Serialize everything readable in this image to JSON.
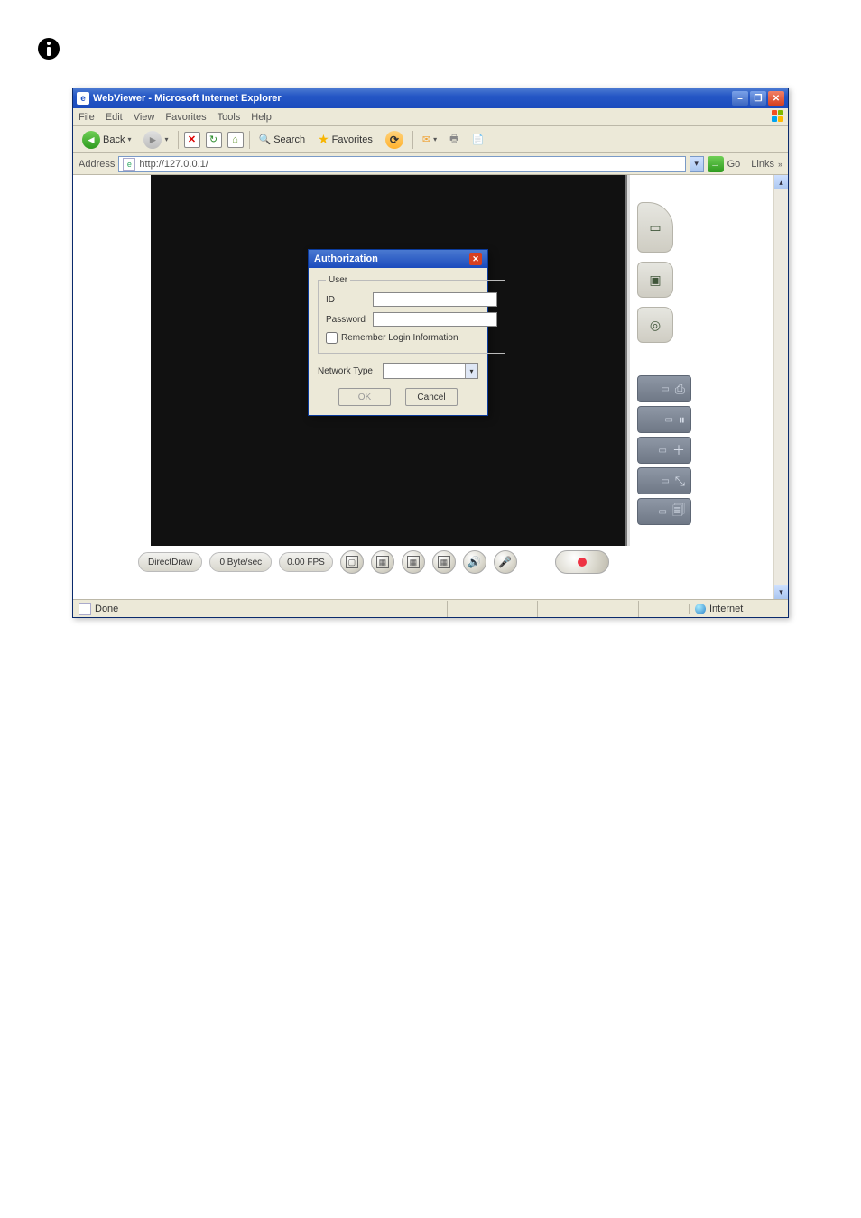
{
  "titlebar": {
    "title": "WebViewer - Microsoft Internet Explorer"
  },
  "menubar": {
    "file": "File",
    "edit": "Edit",
    "view": "View",
    "favorites": "Favorites",
    "tools": "Tools",
    "help": "Help"
  },
  "toolbar": {
    "back": "Back",
    "search": "Search",
    "favorites": "Favorites"
  },
  "addressbar": {
    "label": "Address",
    "url": "http://127.0.0.1/",
    "go": "Go",
    "links": "Links"
  },
  "status_strip": {
    "mode": "DirectDraw",
    "rate": "0 Byte/sec",
    "fps": "0.00 FPS"
  },
  "dialog": {
    "title": "Authorization",
    "legend": "User",
    "id_label": "ID",
    "pw_label": "Password",
    "id_value": "",
    "pw_value": "",
    "remember": "Remember Login Information",
    "network_label": "Network Type",
    "network_value": "",
    "ok": "OK",
    "cancel": "Cancel"
  },
  "statusbar": {
    "done": "Done",
    "zone": "Internet"
  }
}
